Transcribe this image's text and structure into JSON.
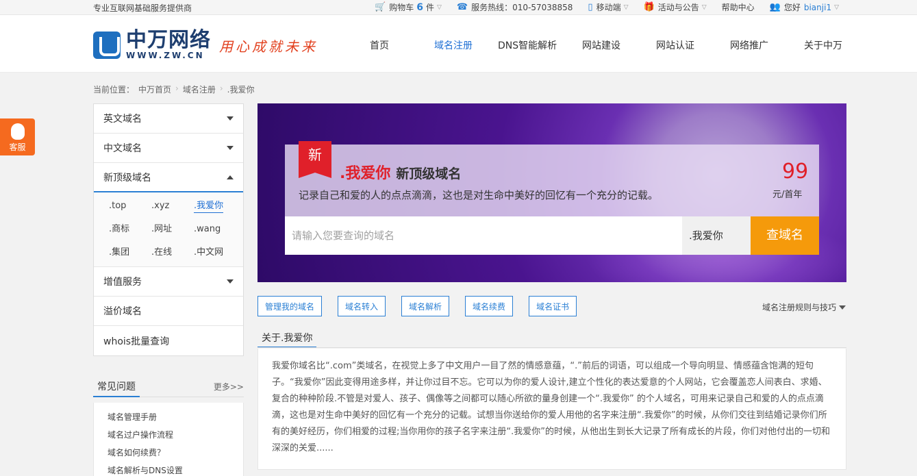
{
  "topbar": {
    "slogan": "专业互联网基础服务提供商",
    "cart_label": "购物车",
    "cart_count": "6",
    "cart_unit": "件",
    "hotline": "服务热线：010-57038858",
    "mobile": "移动端",
    "activity": "活动与公告",
    "help": "帮助中心",
    "greeting": "您好",
    "username": "bianji1"
  },
  "header": {
    "logo_cn": "中万网络",
    "logo_url": "WWW.ZW.CN",
    "logo_slogan": "用心成就未来",
    "nav": [
      "首页",
      "域名注册",
      "DNS智能解析",
      "网站建设",
      "网站认证",
      "网络推广",
      "关于中万"
    ]
  },
  "breadcrumb": [
    "当前位置：",
    "中万首页",
    "域名注册",
    ".我爱你"
  ],
  "kefu": "客服",
  "sidebar": {
    "items": [
      "英文域名",
      "中文域名",
      "新顶级域名"
    ],
    "tlds": [
      ".top",
      ".xyz",
      ".我爱你",
      ".商标",
      ".网址",
      ".wang",
      ".集团",
      ".在线",
      ".中文网"
    ],
    "more_items": [
      "增值服务",
      "溢价域名",
      "whois批量查询"
    ]
  },
  "faq": {
    "title": "常见问题",
    "more": "更多>>",
    "items": [
      "域名管理手册",
      "域名过户操作流程",
      "域名如何续费？",
      "域名解析与DNS设置"
    ]
  },
  "banner": {
    "tag": "新",
    "tld": ".我爱你",
    "kind": "新顶级域名",
    "desc": "记录自己和爱的人的点点滴滴，这也是对生命中美好的回忆有一个充分的记载。",
    "price": "99",
    "unit": "元/首年",
    "placeholder": "请输入您要查询的域名",
    "suffix": ".我爱你",
    "button": "查域名"
  },
  "actions": [
    "管理我的域名",
    "域名转入",
    "域名解析",
    "域名续费",
    "域名证书"
  ],
  "rules": "域名注册规则与技巧",
  "about": {
    "tab": "关于.我爱你",
    "text": "我爱你域名比“.com”类域名，在视觉上多了中文用户一目了然的情感意蕴，“.”前后的词语，可以组成一个导向明显、情感蕴含饱满的短句子。“我爱你”因此变得用途多样，并让你过目不忘。它可以为你的爱人设计,建立个性化的表达爱意的个人网站，它会覆盖恋人间表白、求婚、复合的种种阶段.不管是对爱人、孩子、偶像等之间都可以随心所欲的量身创建一个“.我爱你” 的个人域名，可用来记录自己和爱的人的点点滴滴，这也是对生命中美好的回忆有一个充分的记载。试想当你送给你的爱人用他的名字来注册“.我爱你”的时候，从你们交往到结婚记录你们所有的美好经历，你们相爱的过程;当你用你的孩子名字来注册“.我爱你”的时候，从他出生到长大记录了所有成长的片段，你们对他付出的一切和深深的关爱......"
  },
  "colors": {
    "accent": "#2a7fd4",
    "price": "#e0202a",
    "search_button": "#f59a0b",
    "kefu": "#f56a1f"
  }
}
